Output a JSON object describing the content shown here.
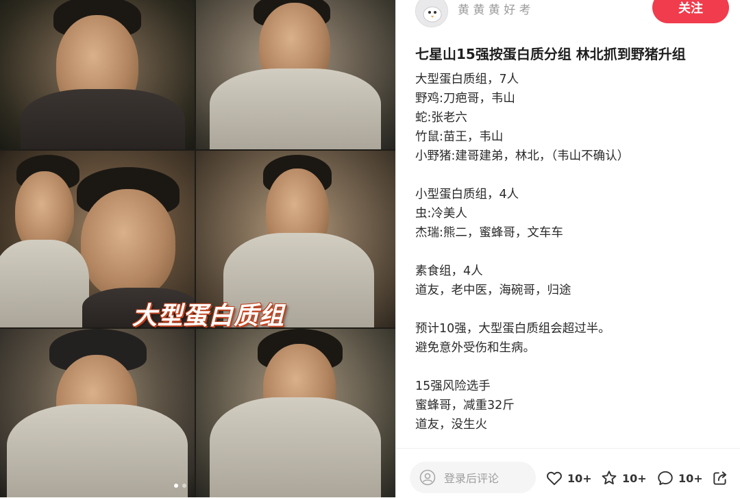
{
  "post": {
    "author_name": "黄 黄 黄 好 考",
    "follow_label": "关注",
    "title": "七星山15强按蛋白质分组 林北抓到野猪升组",
    "body_lines": [
      "大型蛋白质组，7人",
      "野鸡:刀疤哥，韦山",
      "蛇:张老六",
      "竹鼠:苗王，韦山",
      "小野猪:建哥建弟，林北，（韦山不确认）",
      "",
      "小型蛋白质组，4人",
      "虫:冷美人",
      "杰瑞:熊二，蜜蜂哥，文车车",
      "",
      "素食组，4人",
      "道友，老中医，海碗哥，归途",
      "",
      "预计10强，大型蛋白质组会超过半。",
      "避免意外受伤和生病。",
      "",
      "15强风险选手",
      "蜜蜂哥，减重32斤",
      "道友，没生火"
    ]
  },
  "image": {
    "caption": "大型蛋白质组",
    "page_count": 2,
    "current_page": 1
  },
  "bottom_bar": {
    "comment_placeholder": "登录后评论",
    "like_count": "10+",
    "collect_count": "10+",
    "comment_count": "10+"
  },
  "colors": {
    "follow_button": "#f03c4c",
    "caption_outline": "#c1421e"
  },
  "icons": {
    "avatar": "cartoon-bird-avatar",
    "like": "heart-icon",
    "collect": "star-icon",
    "comment": "chat-bubble-icon",
    "share": "share-icon",
    "comment_user": "user-circle-icon"
  }
}
